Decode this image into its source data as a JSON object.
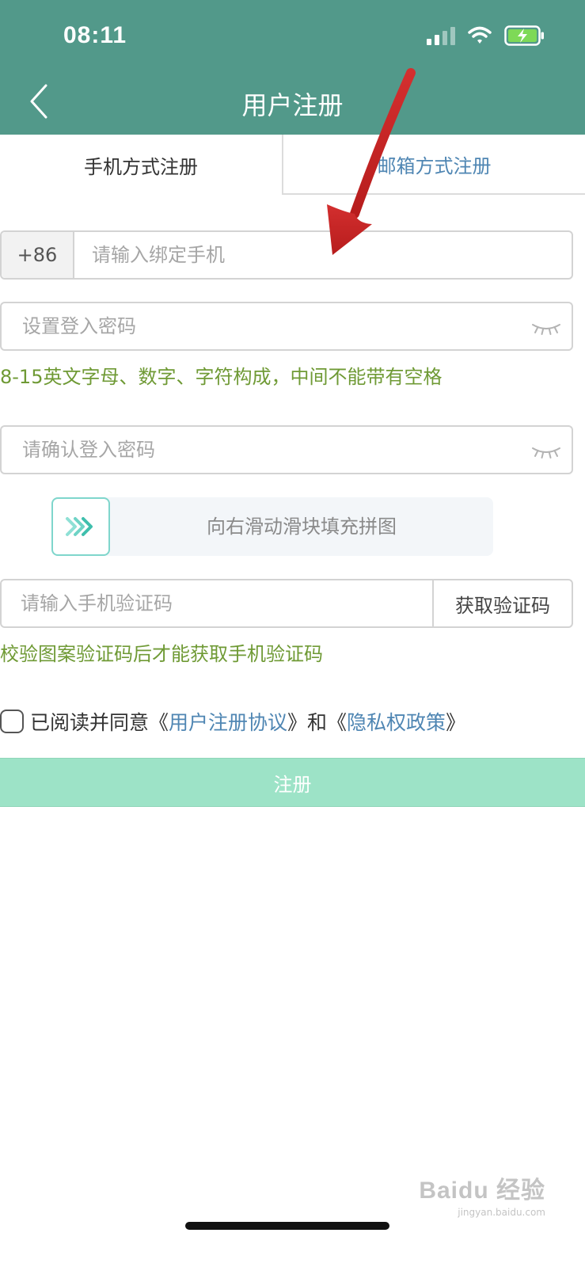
{
  "status_bar": {
    "time": "08:11"
  },
  "header": {
    "title": "用户注册"
  },
  "tabs": [
    {
      "label": "手机方式注册",
      "active": true
    },
    {
      "label": "邮箱方式注册",
      "active": false
    }
  ],
  "form": {
    "country_code": "+86",
    "phone_placeholder": "请输入绑定手机",
    "password_placeholder": "设置登入密码",
    "password_hint": "8-15英文字母、数字、字符构成，中间不能带有空格",
    "confirm_password_placeholder": "请确认登入密码",
    "slider_text": "向右滑动滑块填充拼图",
    "code_placeholder": "请输入手机验证码",
    "get_code_label": "获取验证码",
    "code_hint": "校验图案验证码后才能获取手机验证码"
  },
  "agreement": {
    "prefix": "已阅读并同意《",
    "user_agreement": "用户注册协议",
    "middle": "》和《",
    "privacy_policy": "隐私权政策",
    "suffix": "》"
  },
  "register_label": "注册",
  "watermark": {
    "brand": "Baidu 经验",
    "url": "jingyan.baidu.com"
  },
  "colors": {
    "header_bg": "#52998a",
    "hint_text": "#6f9a35",
    "link_text": "#4f86b3",
    "register_bg": "#9de3c7",
    "annotation_arrow": "#c62828"
  }
}
